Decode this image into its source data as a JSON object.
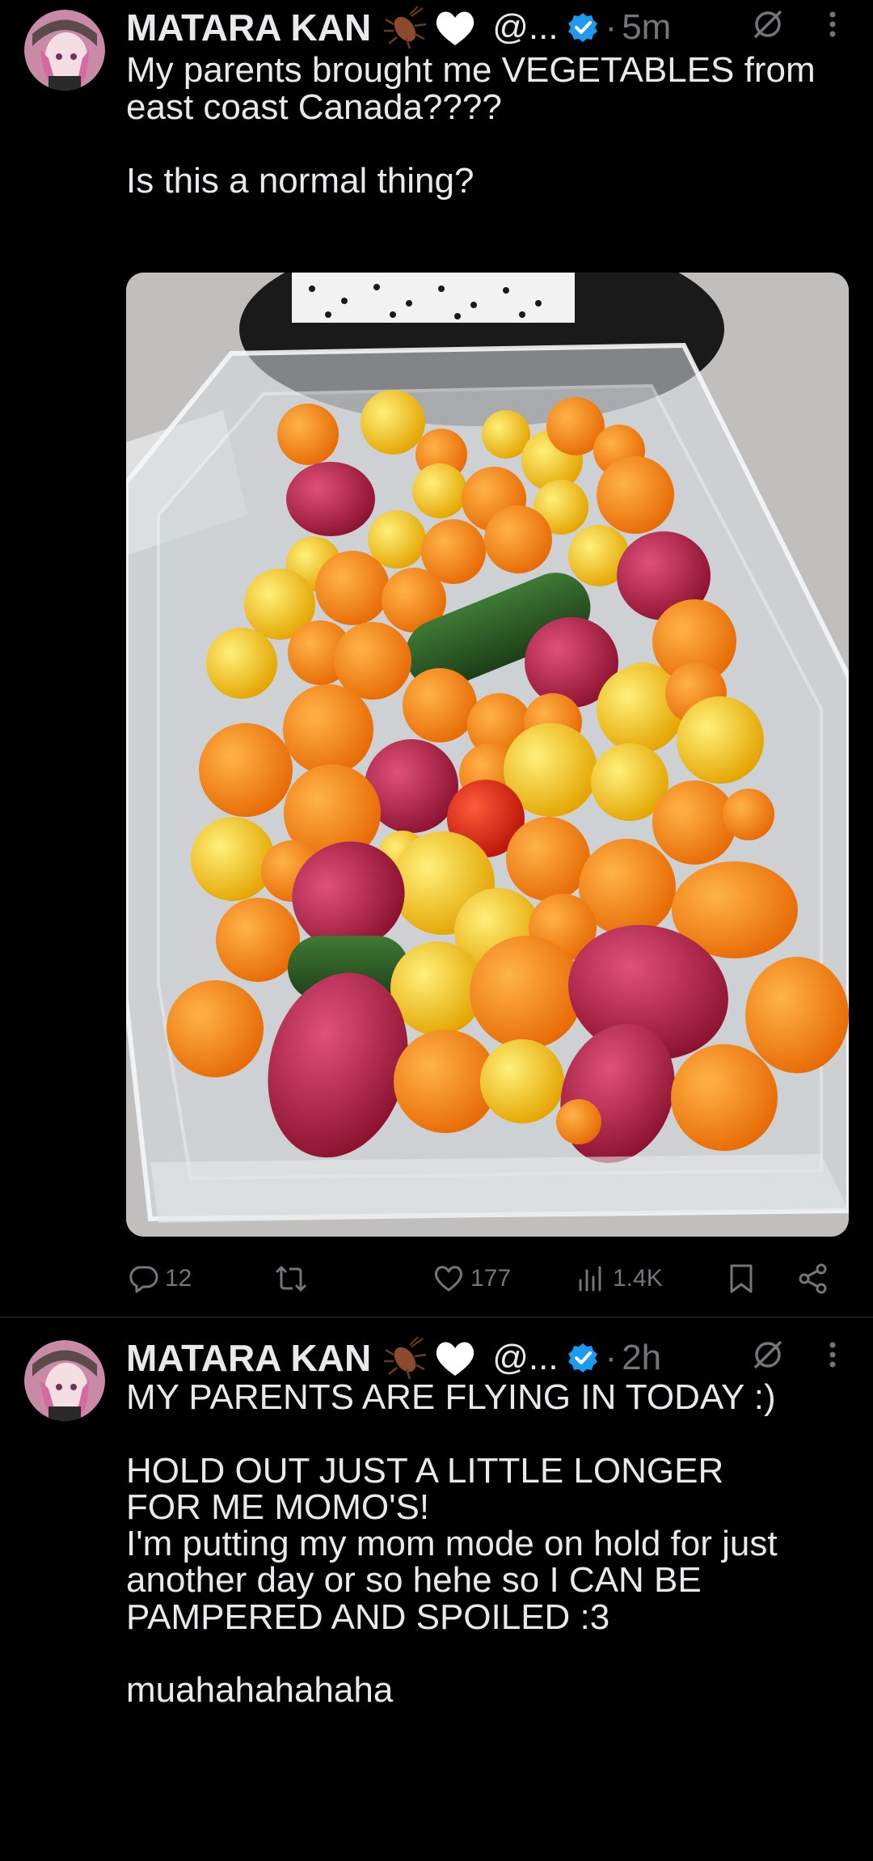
{
  "tweets": [
    {
      "author_name": "MATARA KAN",
      "handle": "@...",
      "separator": "·",
      "time": "5m",
      "text": "My parents brought me VEGETABLES from east coast Canada????\n\nIs this a normal thing?",
      "stats": {
        "replies": "12",
        "likes": "177",
        "views": "1.4K"
      }
    },
    {
      "author_name": "MATARA KAN",
      "handle": "@...",
      "separator": "·",
      "time": "2h",
      "text": "MY PARENTS ARE FLYING IN TODAY :)\n\nHOLD OUT JUST A LITTLE LONGER\nFOR ME MOMO'S!\nI'm putting my mom mode on hold for just another day or so hehe so I CAN BE PAMPERED AND SPOILED :3\n\nmuahahahahaha"
    }
  ],
  "icons": {
    "reply": "reply-icon",
    "retweet": "retweet-icon",
    "like": "heart-icon",
    "views": "views-icon",
    "bookmark": "bookmark-icon",
    "share": "share-icon",
    "verified": "verified-badge-icon",
    "muted": "muted-icon",
    "more": "more-icon",
    "cockroach": "cockroach-emoji-icon",
    "heart_emoji": "white-heart-emoji-icon"
  },
  "colors": {
    "background": "#000000",
    "text": "#e7e9ea",
    "muted": "#71767b",
    "verified": "#1d9bf0"
  }
}
